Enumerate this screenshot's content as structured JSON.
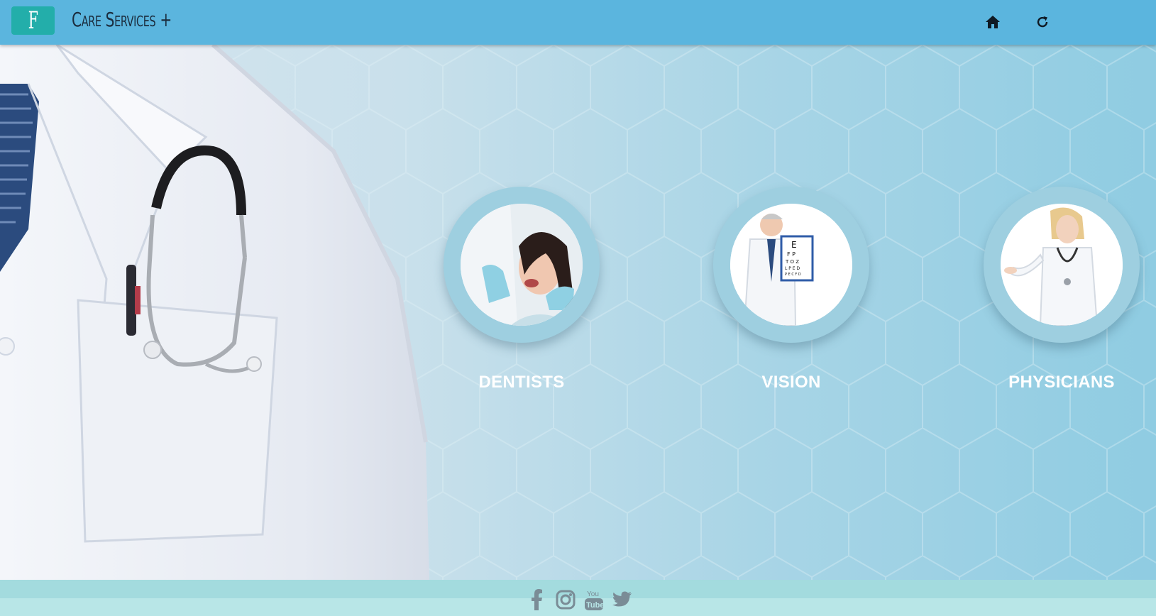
{
  "header": {
    "logo_letter": "F",
    "brand_name": "Care Services",
    "brand_plus": "+",
    "nav_icons": [
      "home-icon",
      "refresh-icon"
    ]
  },
  "services": [
    {
      "label": "DENTISTS",
      "image": "dentist-photo"
    },
    {
      "label": "VISION",
      "image": "eye-doctor-photo"
    },
    {
      "label": "PHYSICIANS",
      "image": "physician-photo"
    }
  ],
  "footer": {
    "social_icons": [
      "facebook-icon",
      "instagram-icon",
      "youtube-icon",
      "twitter-icon"
    ],
    "youtube_text_top": "You",
    "youtube_text_bottom": "Tube"
  },
  "colors": {
    "header_bg": "#5bb5de",
    "logo_bg": "#23aeaa",
    "brand_text": "#1b2d3e",
    "service_label": "#ffffff",
    "footer_band": "#a3dbde",
    "social_icon": "#7a8c96"
  }
}
